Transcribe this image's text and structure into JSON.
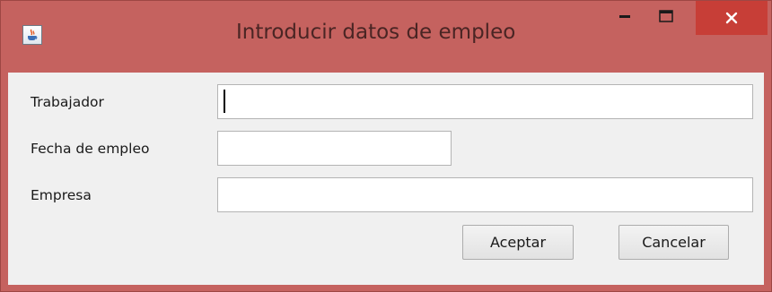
{
  "window": {
    "title": "Introducir datos de empleo",
    "icon": "java-cup-icon",
    "controls": [
      "minimize-icon",
      "maximize-icon",
      "close-icon"
    ],
    "colors": {
      "frame": "#c5625f",
      "close_button": "#c73e37",
      "content_background": "#f0f0f0"
    }
  },
  "form": {
    "fields": [
      {
        "label": "Trabajador",
        "value": ""
      },
      {
        "label": "Fecha de empleo",
        "value": ""
      },
      {
        "label": "Empresa",
        "value": ""
      }
    ],
    "accept_label": "Aceptar",
    "cancel_label": "Cancelar"
  }
}
